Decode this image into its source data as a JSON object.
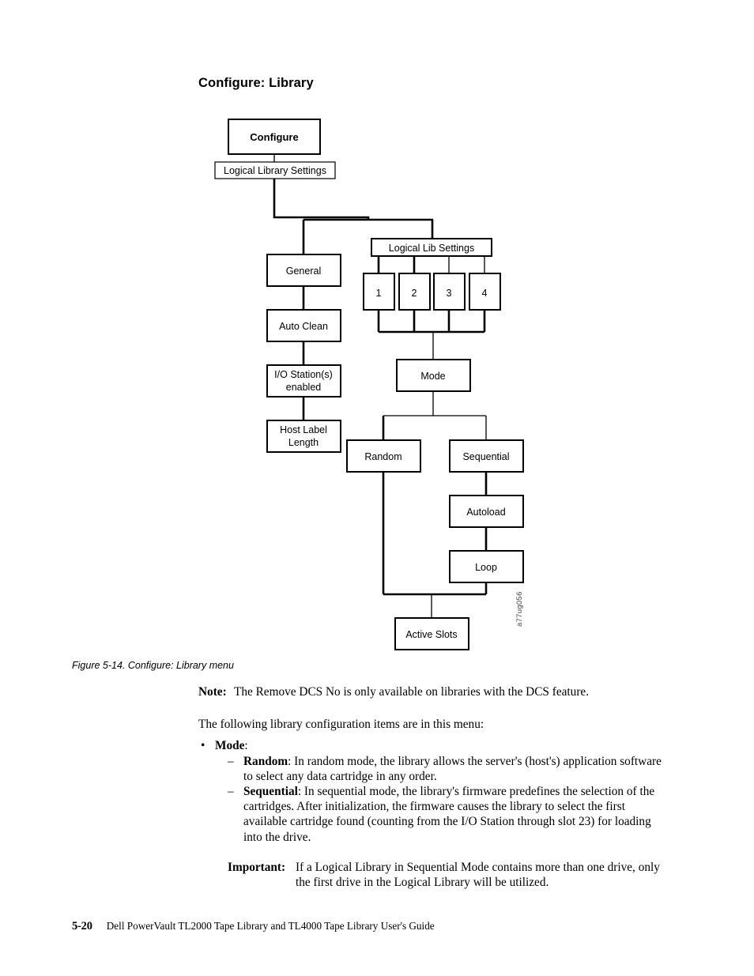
{
  "page": {
    "title": "Configure: Library"
  },
  "figure": {
    "caption": "Figure 5-14. Configure: Library menu",
    "art_code": "a77ug056",
    "nodes": {
      "configure": "Configure",
      "logical_library_settings": "Logical Library Settings",
      "general": "General",
      "auto_clean": "Auto Clean",
      "io_station_line1": "I/O Station(s)",
      "io_station_line2": "enabled",
      "host_label_line1": "Host Label",
      "host_label_line2": "Length",
      "logical_lib_settings": "Logical Lib Settings",
      "lib_1": "1",
      "lib_2": "2",
      "lib_3": "3",
      "lib_4": "4",
      "mode": "Mode",
      "random": "Random",
      "sequential": "Sequential",
      "autoload": "Autoload",
      "loop": "Loop",
      "active_slots": "Active Slots"
    }
  },
  "body": {
    "note": {
      "lead": "Note:",
      "text": "The Remove DCS No is only available on libraries with the DCS feature."
    },
    "intro": "The following library configuration items are in this menu:",
    "bullets": [
      {
        "marker": "•",
        "term": "Mode",
        "after_term": ":"
      }
    ],
    "sub_items": [
      {
        "marker": "–",
        "term": "Random",
        "text": ": In random mode, the library allows the server's (host's) application software to select any data cartridge in any order."
      },
      {
        "marker": "–",
        "term": "Sequential",
        "text": ": In sequential mode, the library's firmware predefines the selection of the cartridges. After initialization, the firmware causes the library to select the first available cartridge found (counting from the I/O Station through slot 23) for loading into the drive."
      }
    ],
    "important": {
      "lead": "Important:",
      "text": "If a Logical Library in Sequential Mode contains more than one drive, only the first drive in the Logical Library will be utilized."
    }
  },
  "footer": {
    "page_number": "5-20",
    "running_head": "Dell PowerVault TL2000 Tape Library and TL4000 Tape Library User's Guide"
  },
  "colors": {
    "text": "#000000",
    "line": "#000000",
    "background": "#ffffff",
    "art_code": "#444444"
  }
}
